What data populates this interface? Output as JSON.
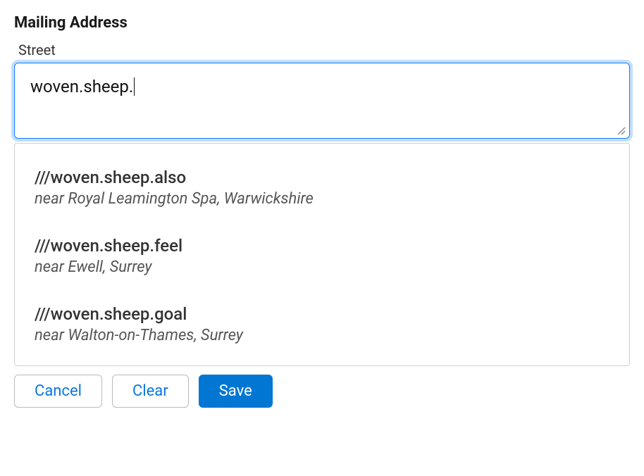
{
  "section": {
    "title": "Mailing Address"
  },
  "street": {
    "label": "Street",
    "value": "woven.sheep."
  },
  "dropdown": {
    "items": [
      {
        "main": "///woven.sheep.also",
        "sub": "near Royal Leamington Spa, Warwickshire"
      },
      {
        "main": "///woven.sheep.feel",
        "sub": "near Ewell, Surrey"
      },
      {
        "main": "///woven.sheep.goal",
        "sub": "near Walton-on-Thames, Surrey"
      }
    ]
  },
  "buttons": {
    "cancel": "Cancel",
    "clear": "Clear",
    "save": "Save"
  }
}
